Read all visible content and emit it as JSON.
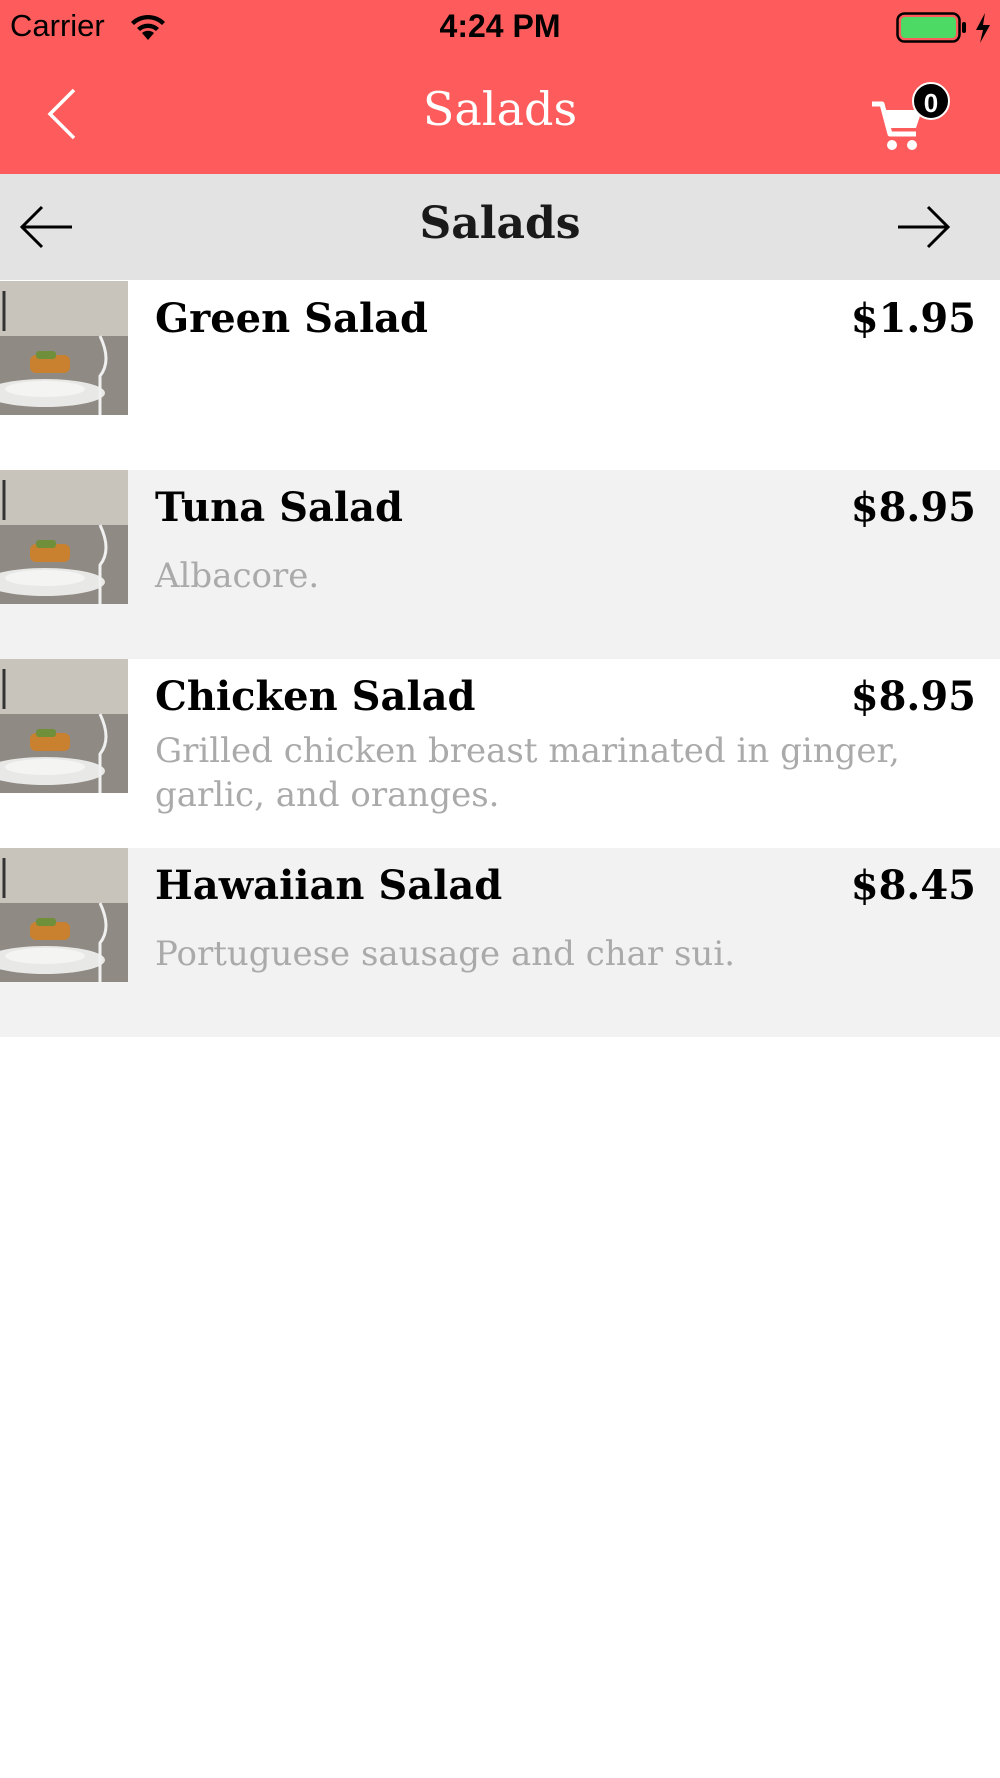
{
  "status_bar": {
    "carrier": "Carrier",
    "time": "4:24 PM",
    "battery_color": "#4cd964"
  },
  "nav": {
    "title": "Salads",
    "back_icon": "chevron-left-icon",
    "cart_icon": "shopping-cart-icon",
    "cart_count": "0",
    "background_color": "#fe5c5c"
  },
  "category": {
    "title": "Salads",
    "prev_icon": "arrow-left-icon",
    "next_icon": "arrow-right-icon"
  },
  "items": [
    {
      "name": "Green Salad",
      "price": "$1.95",
      "description": ""
    },
    {
      "name": "Tuna Salad",
      "price": "$8.95",
      "description": "Albacore."
    },
    {
      "name": "Chicken Salad",
      "price": "$8.95",
      "description": "Grilled chicken breast marinated in ginger, garlic, and oranges."
    },
    {
      "name": "Hawaiian Salad",
      "price": "$8.45",
      "description": "Portuguese sausage and char sui."
    }
  ]
}
